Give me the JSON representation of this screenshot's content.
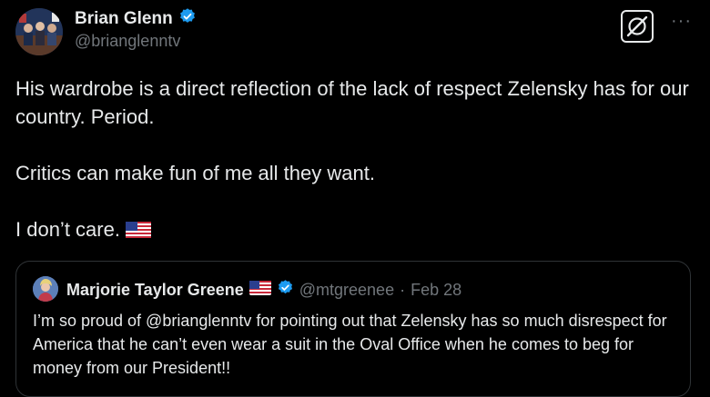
{
  "author": {
    "display_name": "Brian Glenn",
    "handle": "@brianglenntv",
    "verified": true
  },
  "tweet": {
    "text": "His wardrobe is a direct reflection of the lack of respect Zelensky has for our country. Period.\n\nCritics can make fun of me all they want.\n\nI don’t care."
  },
  "quote": {
    "display_name": "Marjorie Taylor Greene",
    "handle": "@mtgreenee",
    "separator": "·",
    "date": "Feb 28",
    "text": "I’m so proud of @brianglenntv for pointing out that Zelensky has so much disrespect for America that he can’t even wear a suit in the Oval Office when he comes to beg for money from our President!!"
  },
  "icons": {
    "grok": "grok-icon",
    "more": "more-icon",
    "verified": "verified-badge-icon",
    "flag": "us-flag-icon"
  },
  "colors": {
    "background": "#000000",
    "text": "#e7e9ea",
    "muted": "#71767b",
    "verified": "#1d9bf0",
    "border": "#2f3336"
  }
}
